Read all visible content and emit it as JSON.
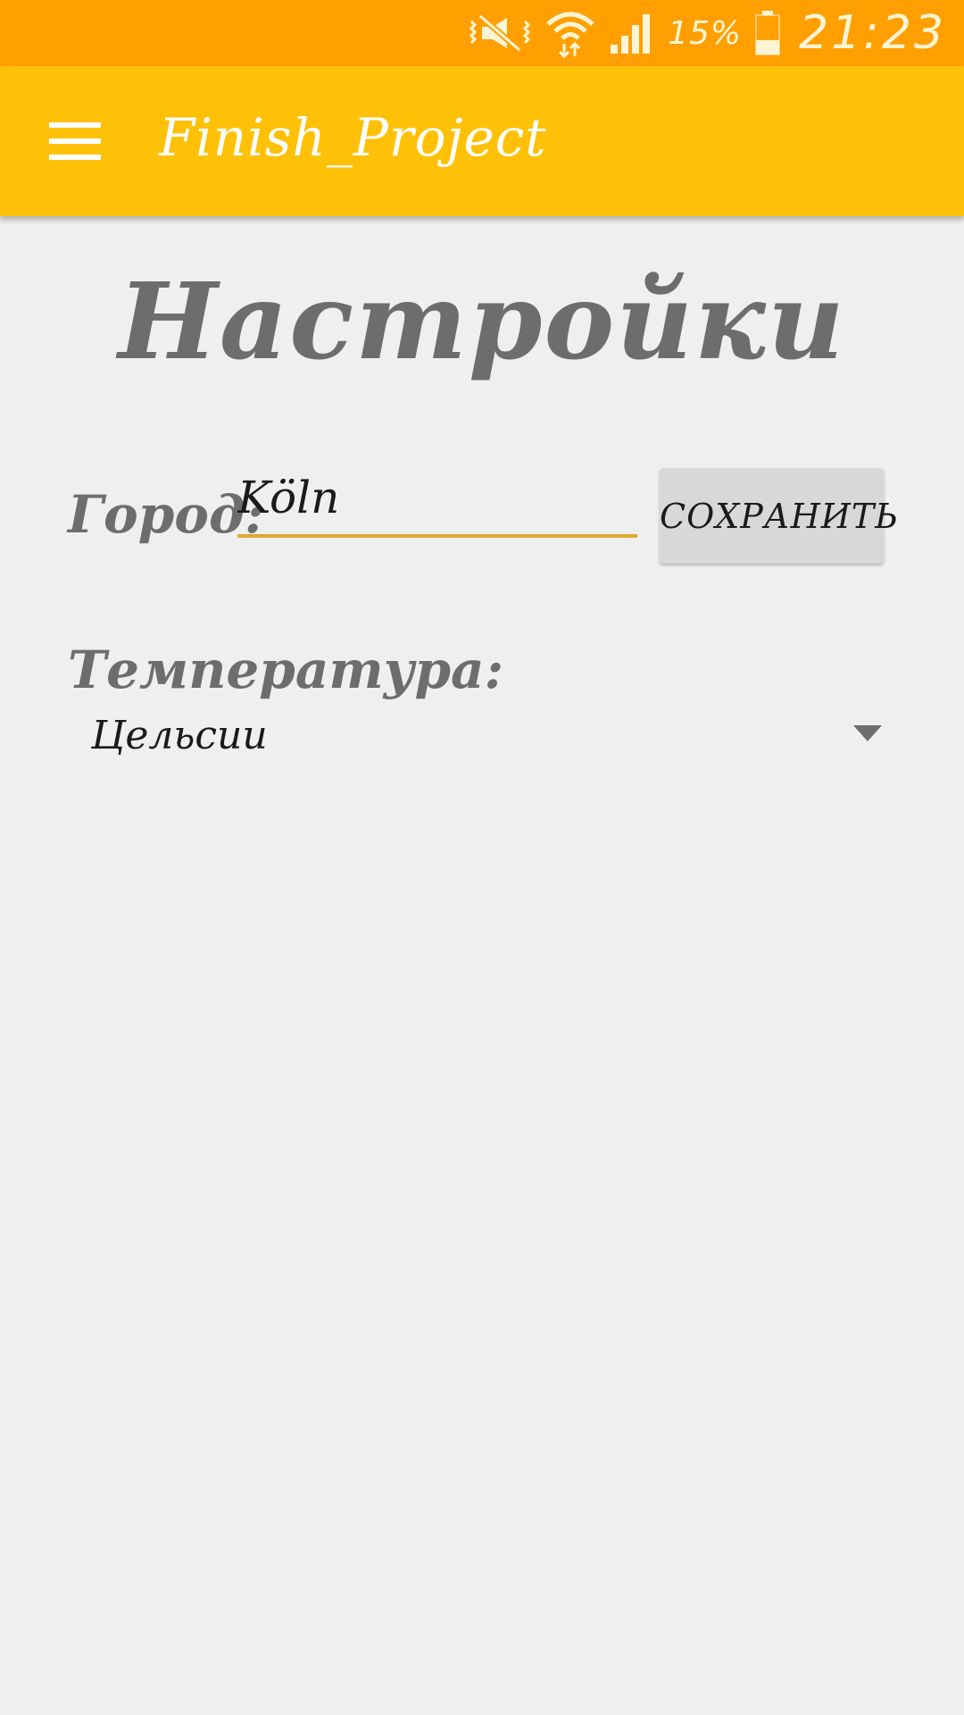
{
  "status_bar": {
    "battery_percent": "15%",
    "time": "21:23",
    "icons": [
      "vibrate-mute-icon",
      "wifi-icon",
      "signal-icon",
      "battery-icon"
    ]
  },
  "app_bar": {
    "title": "Finish_Project",
    "menu_icon": "hamburger-menu-icon"
  },
  "page": {
    "title": "Настройки"
  },
  "city": {
    "label": "Город:",
    "value": "Köln",
    "save_label": "СОХРАНИТЬ"
  },
  "temperature": {
    "label": "Температура:",
    "selected": "Цельсии"
  },
  "colors": {
    "status_bar": "#ffa000",
    "app_bar": "#ffc107",
    "background": "#efefef",
    "accent_underline": "#e0a82e",
    "label_gray": "#6d6d6d",
    "button_gray": "#d7d8d7"
  }
}
